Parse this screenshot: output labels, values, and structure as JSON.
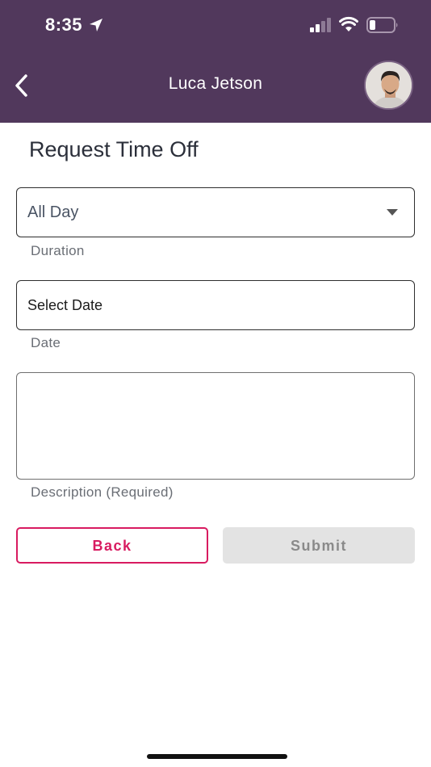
{
  "status_bar": {
    "time": "8:35"
  },
  "header": {
    "title": "Luca Jetson",
    "color": "#51385c"
  },
  "form": {
    "title": "Request Time Off",
    "duration": {
      "value": "All Day",
      "label": "Duration"
    },
    "date": {
      "value": "Select Date",
      "label": "Date"
    },
    "description": {
      "value": "",
      "label": "Description (Required)"
    }
  },
  "buttons": {
    "back_label": "Back",
    "submit_label": "Submit",
    "back_color": "#d81b60"
  }
}
